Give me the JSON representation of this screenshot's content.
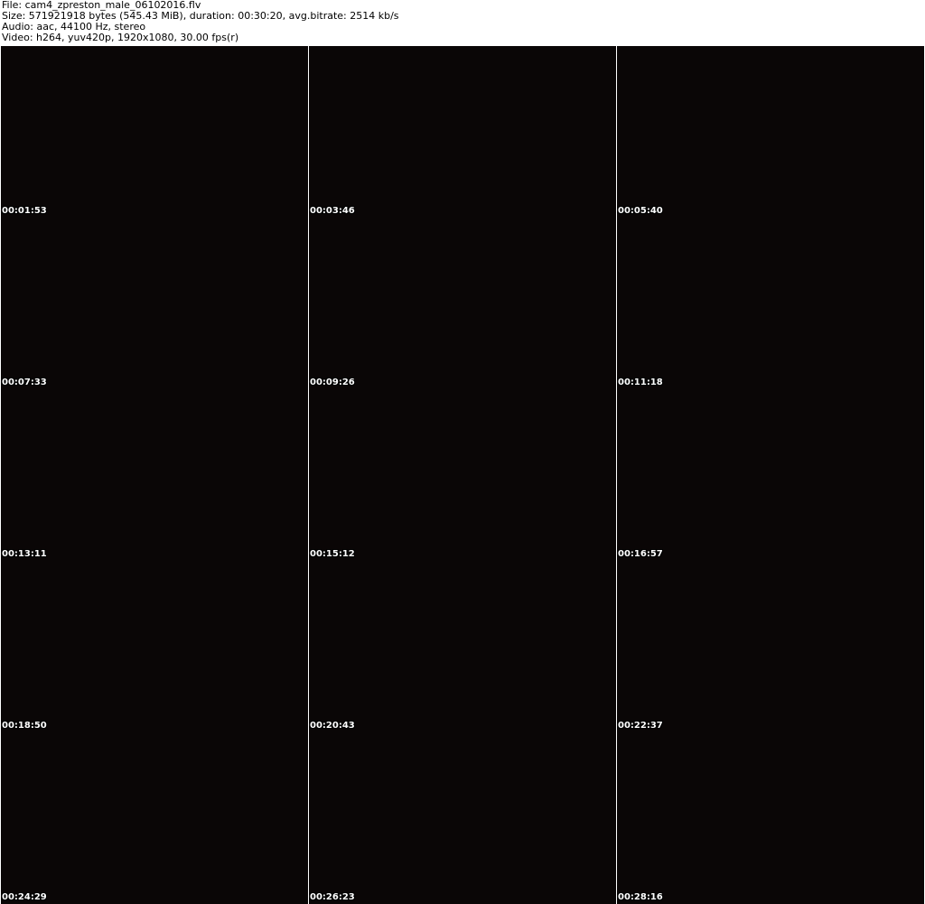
{
  "header": {
    "file_line": "File: cam4_zpreston_male_06102016.flv",
    "size_line": "Size: 571921918 bytes (545.43 MiB), duration: 00:30:20, avg.bitrate: 2514 kb/s",
    "audio_line": "Audio: aac, 44100 Hz, stereo",
    "video_line": "Video: h264, yuv420p, 1920x1080, 30.00 fps(r)"
  },
  "thumbnails": [
    {
      "timestamp": "00:01:53"
    },
    {
      "timestamp": "00:03:46"
    },
    {
      "timestamp": "00:05:40"
    },
    {
      "timestamp": "00:07:33"
    },
    {
      "timestamp": "00:09:26"
    },
    {
      "timestamp": "00:11:18"
    },
    {
      "timestamp": "00:13:11"
    },
    {
      "timestamp": "00:15:12"
    },
    {
      "timestamp": "00:16:57"
    },
    {
      "timestamp": "00:18:50"
    },
    {
      "timestamp": "00:20:43"
    },
    {
      "timestamp": "00:22:37"
    },
    {
      "timestamp": "00:24:29"
    },
    {
      "timestamp": "00:26:23"
    },
    {
      "timestamp": "00:28:16"
    }
  ]
}
